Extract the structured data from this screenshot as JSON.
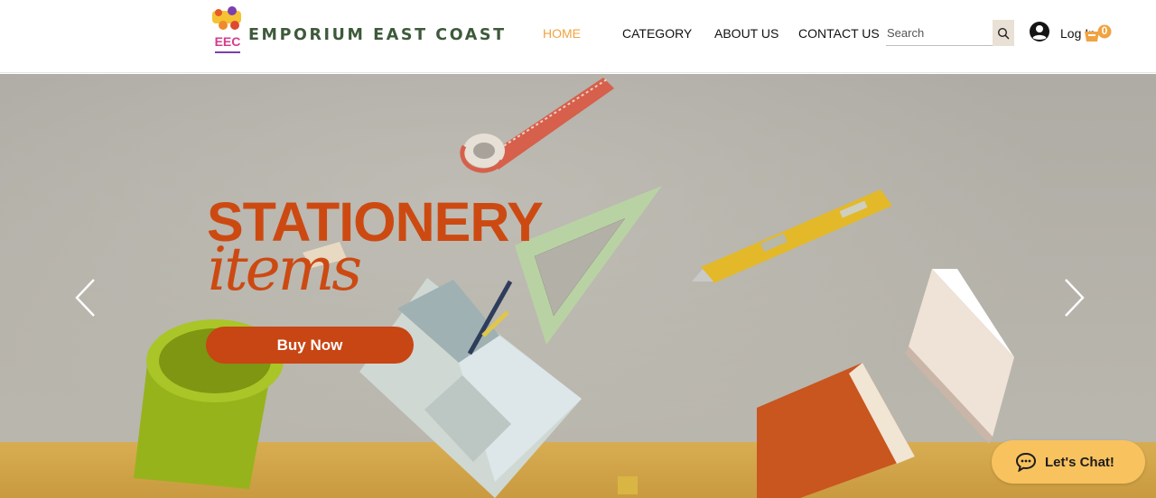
{
  "header": {
    "brand": "EMPORIUM EAST COAST",
    "logo_text": "EEC",
    "nav": [
      {
        "label": "HOME",
        "active": true
      },
      {
        "label": "CATEGORY",
        "active": false
      },
      {
        "label": "ABOUT US",
        "active": false
      },
      {
        "label": "CONTACT US",
        "active": false
      }
    ],
    "search": {
      "placeholder": "Search",
      "icon": "search-icon"
    },
    "login_label": "Log In",
    "cart_count": "0",
    "user_icon": "user-icon",
    "cart_icon": "cart-icon"
  },
  "hero": {
    "title": "STATIONERY",
    "subtitle": "items",
    "cta_label": "Buy Now",
    "prev_icon": "chevron-left-icon",
    "next_icon": "chevron-right-icon"
  },
  "chat": {
    "label": "Let's Chat!",
    "icon": "chat-bubble-icon"
  },
  "colors": {
    "accent": "#f0a341",
    "title": "#cc4a12",
    "cta": "#c84514",
    "brand_text": "#3d5a3a",
    "chat_bg": "#f8c25e"
  }
}
